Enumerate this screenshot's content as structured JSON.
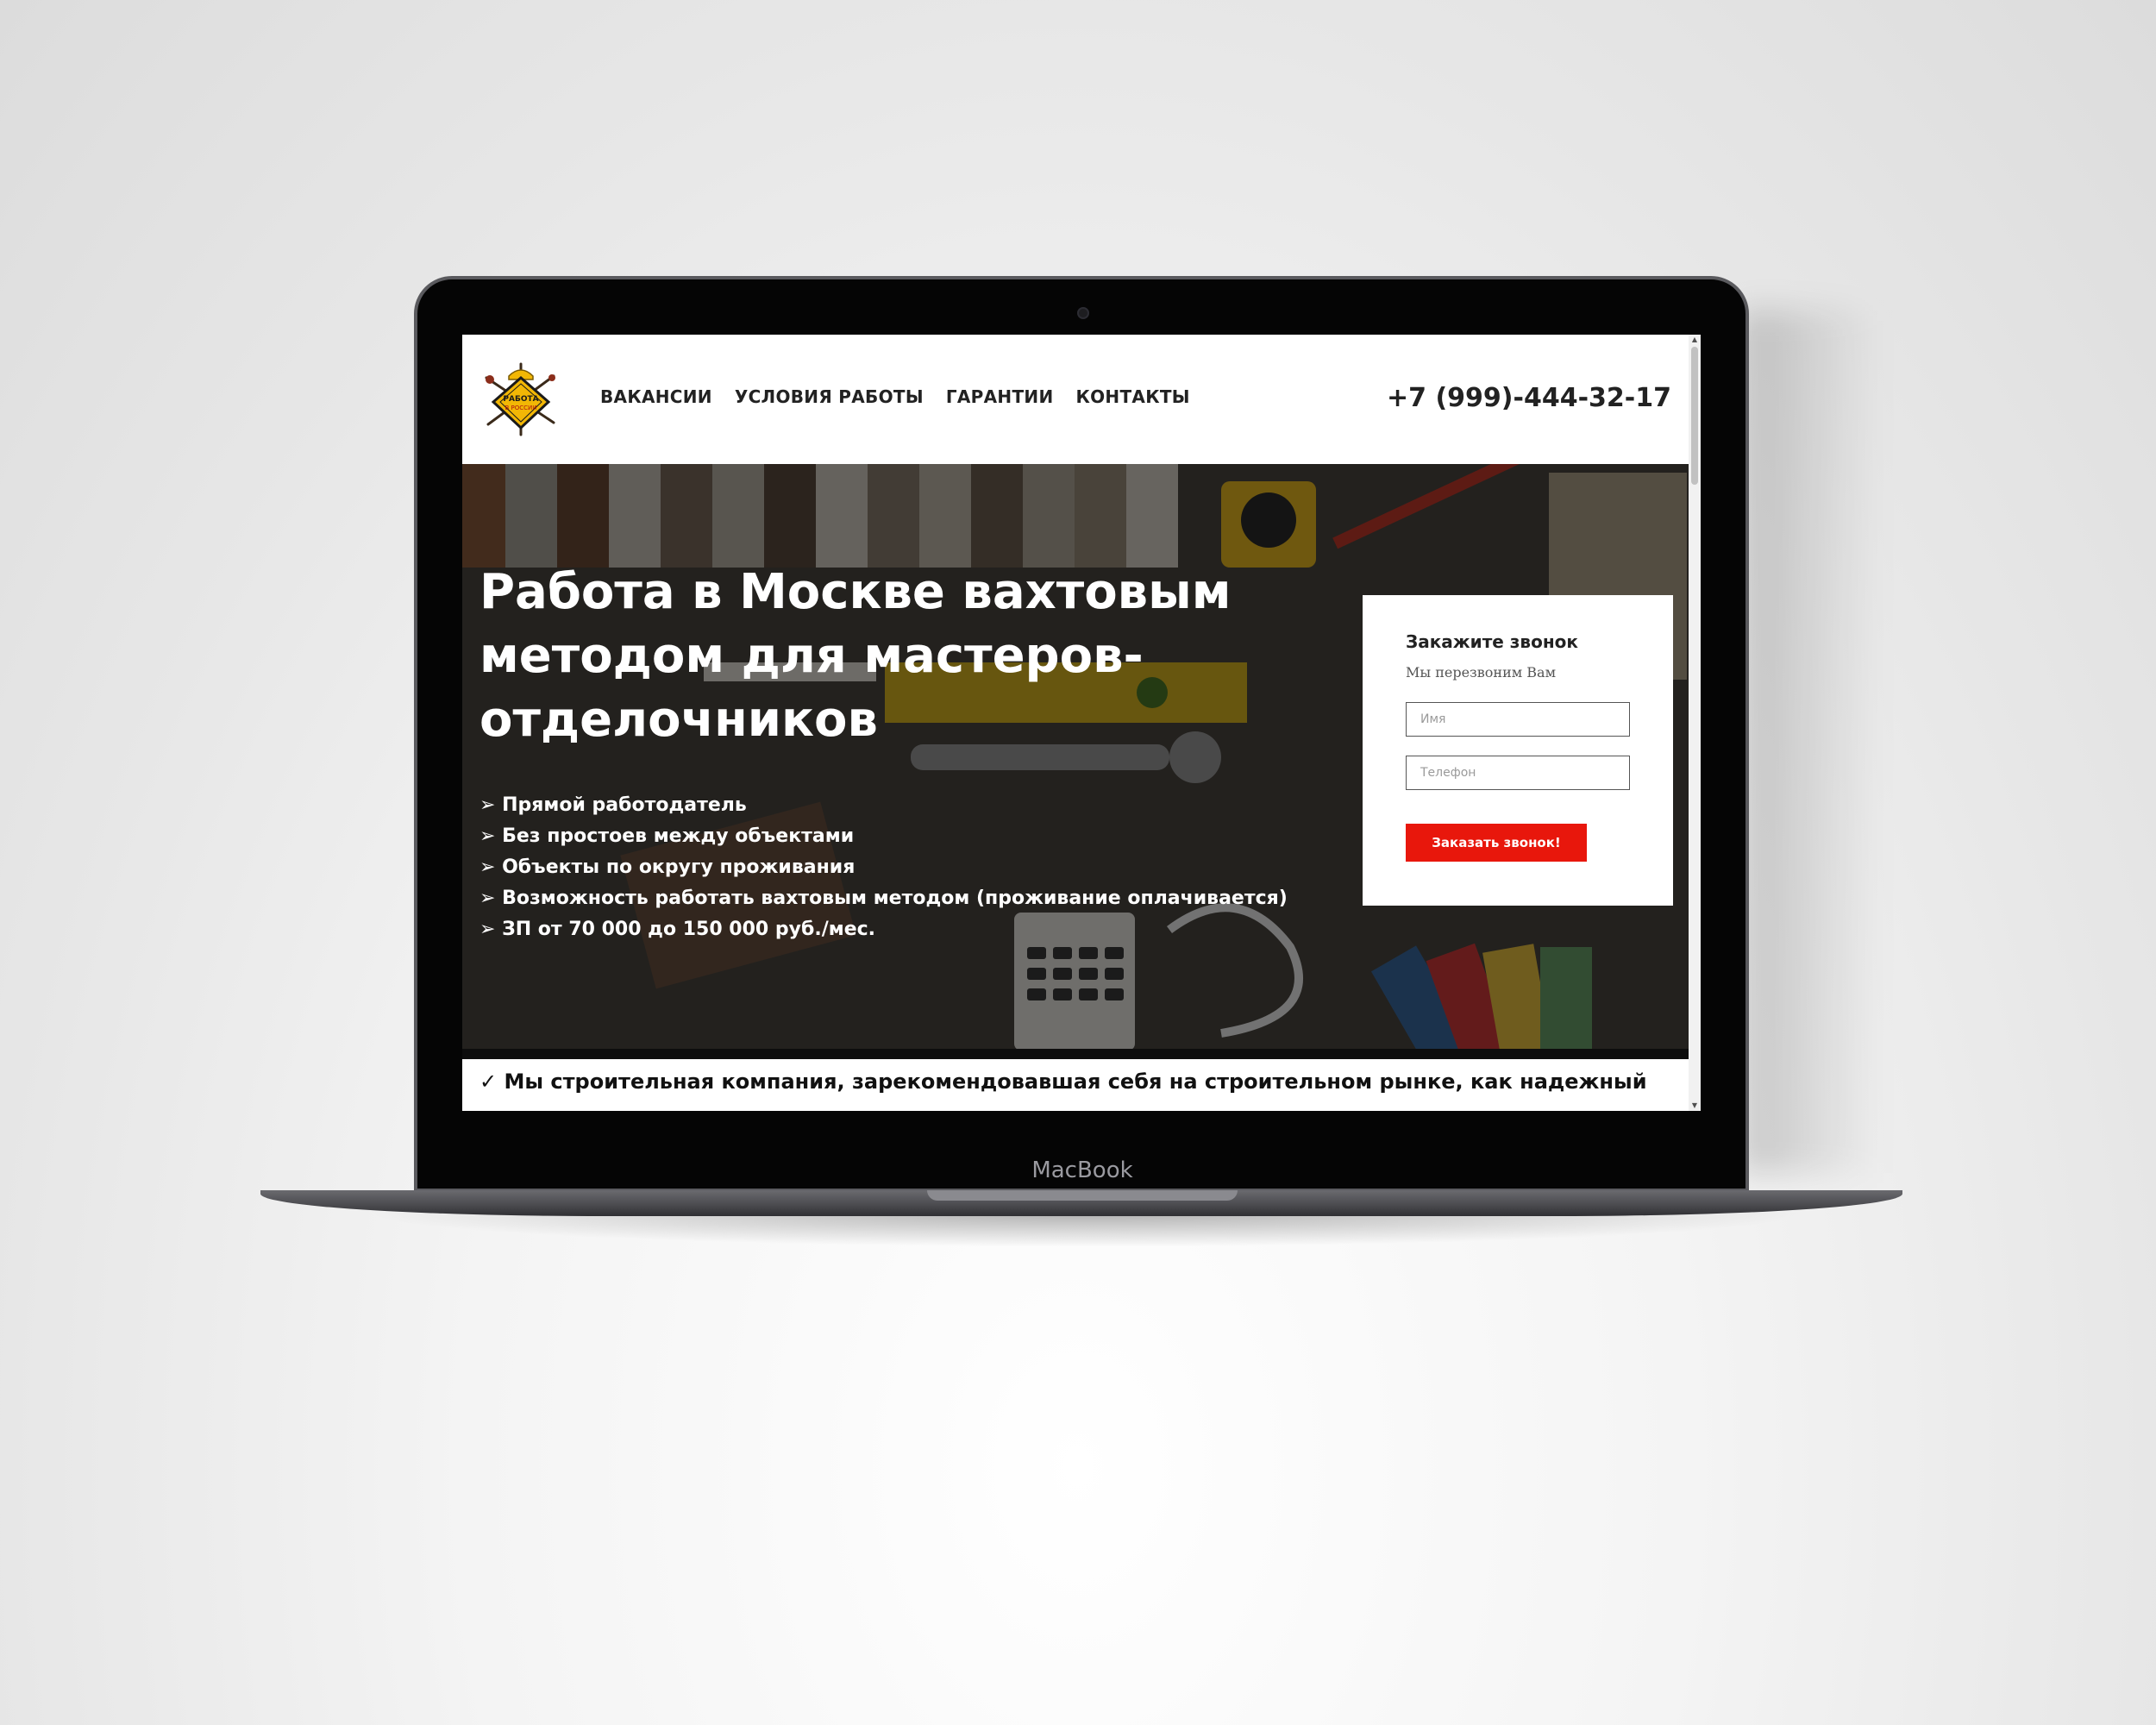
{
  "device": {
    "brand": "MacBook"
  },
  "header": {
    "logo_text": "РАБОТА В РОССИИ",
    "nav": [
      {
        "label": "ВАКАНСИИ"
      },
      {
        "label": "УСЛОВИЯ РАБОТЫ"
      },
      {
        "label": "ГАРАНТИИ"
      },
      {
        "label": "КОНТАКТЫ"
      }
    ],
    "phone": "+7 (999)-444-32-17"
  },
  "hero": {
    "title": "Работа в Москве вахтовым методом для мастеров-отделочников",
    "bullets": [
      "➢ Прямой работодатель",
      "➢ Без простоев между объектами",
      "➢ Объекты по округу проживания",
      "➢ Возможность работать вахтовым методом (проживание оплачивается)",
      "➢ ЗП от 70 000 до 150 000 руб./мес."
    ]
  },
  "callback_form": {
    "title": "Закажите звонок",
    "subtitle": "Мы перезвоним Вам",
    "name_placeholder": "Имя",
    "phone_placeholder": "Телефон",
    "submit_label": "Заказать звонок!"
  },
  "about": {
    "text": "✓ Мы строительная компания, зарекомендовавшая себя на строительном рынке, как надежный"
  },
  "colors": {
    "accent": "#e8170c",
    "logo_yellow": "#f2b705",
    "text_dark": "#222222"
  }
}
